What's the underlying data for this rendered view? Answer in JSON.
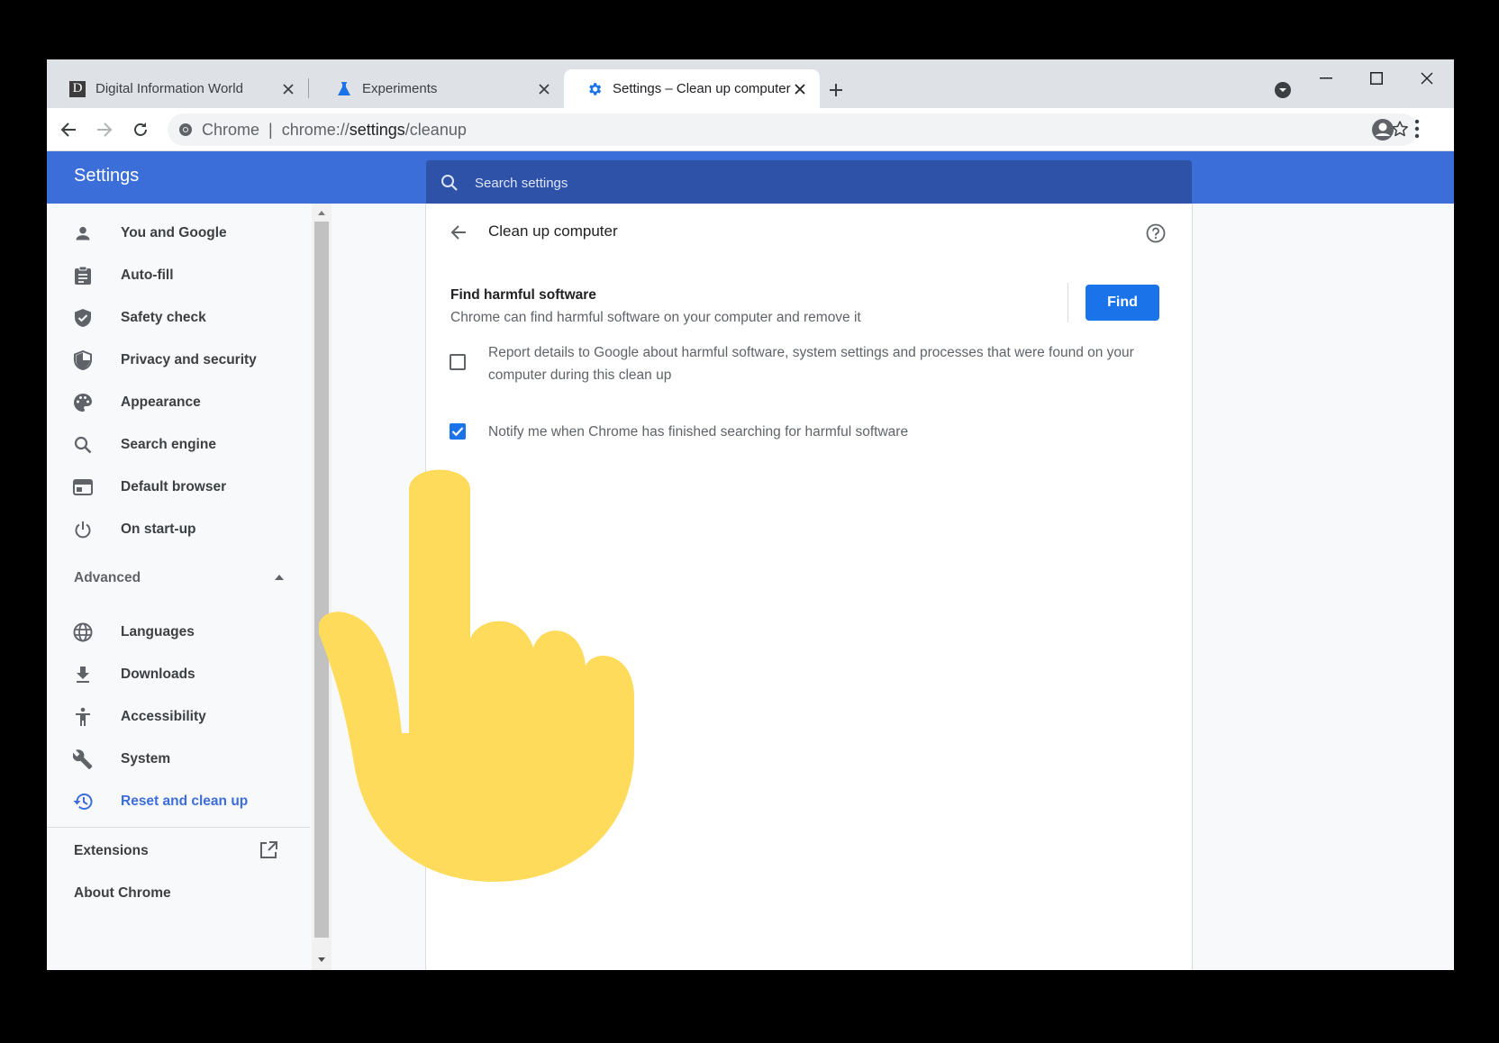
{
  "tabs": [
    {
      "title": "Digital Information World",
      "favicon": "D",
      "active": false
    },
    {
      "title": "Experiments",
      "favicon": "flask-icon",
      "active": false
    },
    {
      "title": "Settings – Clean up computer",
      "favicon": "gear-icon",
      "active": true
    }
  ],
  "omnibox": {
    "site_label": "Chrome",
    "separator": "|",
    "url_scheme": "chrome://",
    "url_host": "settings",
    "url_path": "/cleanup"
  },
  "header": {
    "title": "Settings",
    "search_placeholder": "Search settings"
  },
  "sidebar": {
    "items": [
      {
        "label": "You and Google",
        "icon": "person-icon"
      },
      {
        "label": "Auto-fill",
        "icon": "clipboard-icon"
      },
      {
        "label": "Safety check",
        "icon": "shield-check-icon"
      },
      {
        "label": "Privacy and security",
        "icon": "shield-icon"
      },
      {
        "label": "Appearance",
        "icon": "palette-icon"
      },
      {
        "label": "Search engine",
        "icon": "search-icon"
      },
      {
        "label": "Default browser",
        "icon": "browser-icon"
      },
      {
        "label": "On start-up",
        "icon": "power-icon"
      }
    ],
    "advanced_label": "Advanced",
    "advanced_items": [
      {
        "label": "Languages",
        "icon": "globe-icon"
      },
      {
        "label": "Downloads",
        "icon": "download-icon"
      },
      {
        "label": "Accessibility",
        "icon": "accessibility-icon"
      },
      {
        "label": "System",
        "icon": "wrench-icon"
      },
      {
        "label": "Reset and clean up",
        "icon": "history-icon",
        "active": true
      }
    ],
    "extensions_label": "Extensions",
    "about_label": "About Chrome"
  },
  "page": {
    "title": "Clean up computer",
    "find_title": "Find harmful software",
    "find_description": "Chrome can find harmful software on your computer and remove it",
    "find_button": "Find",
    "report_label": "Report details to Google about harmful software, system settings and processes that were found on your computer during this clean up",
    "report_checked": false,
    "notify_label": "Notify me when Chrome has finished searching for harmful software",
    "notify_checked": true
  },
  "colors": {
    "header_blue": "#3b6ed8",
    "accent": "#1a73e8",
    "hand": "#ffdb5c"
  }
}
